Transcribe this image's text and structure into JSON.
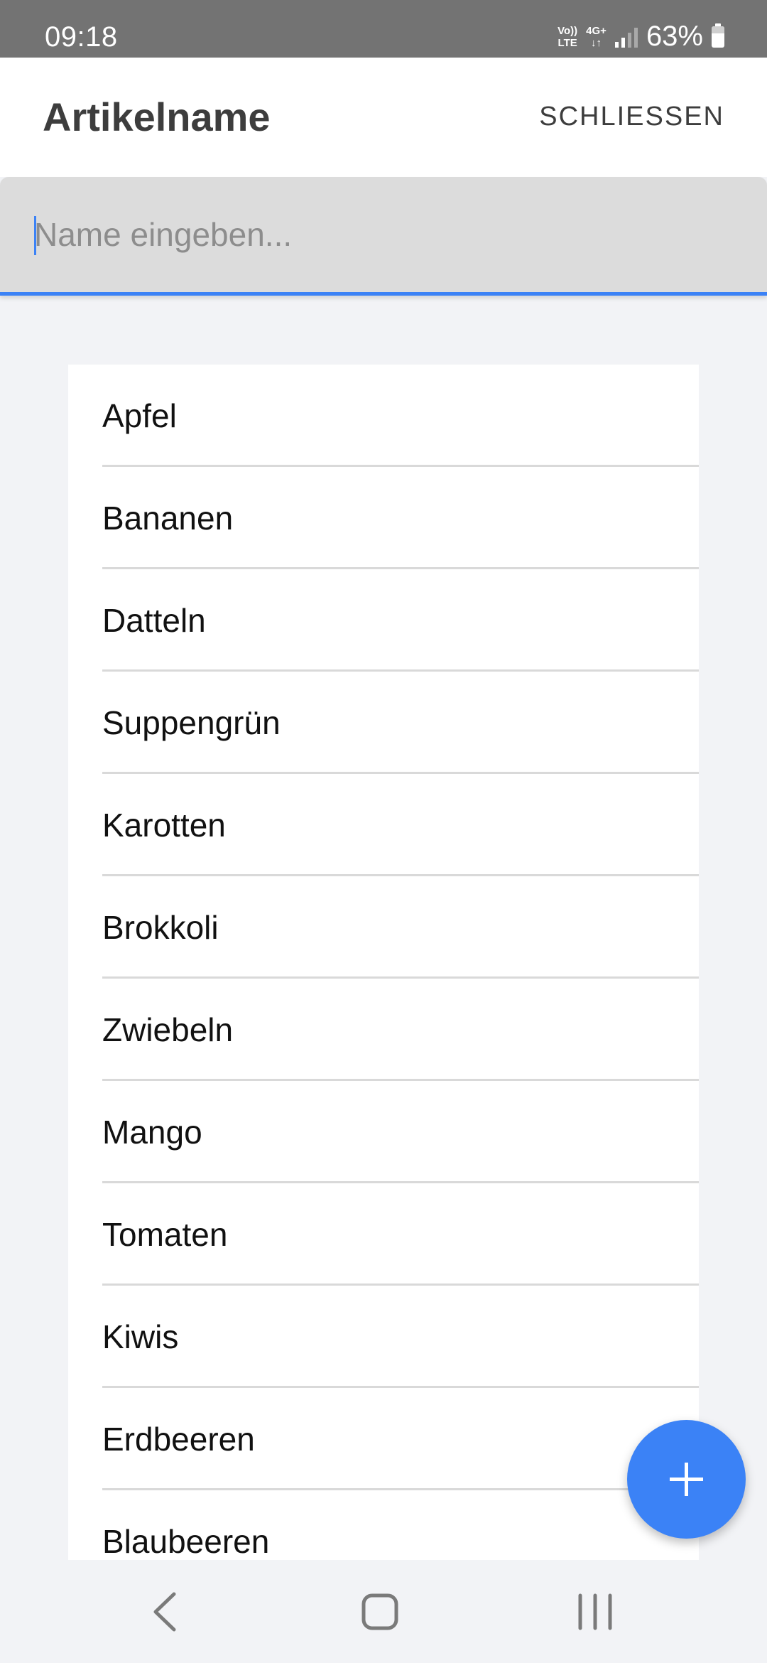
{
  "status_bar": {
    "time": "09:18",
    "volte": "Vo)) LTE",
    "volte_top": "Vo))",
    "volte_bottom": "LTE",
    "network": "4G+",
    "battery_percent": "63%"
  },
  "app_bar": {
    "title": "Artikelname",
    "close_label": "SCHLIESSEN"
  },
  "search": {
    "placeholder": "Name eingeben...",
    "value": ""
  },
  "items": [
    "Apfel",
    "Bananen",
    "Datteln",
    "Suppengrün",
    "Karotten",
    "Brokkoli",
    "Zwiebeln",
    "Mango",
    "Tomaten",
    "Kiwis",
    "Erdbeeren",
    "Blaubeeren"
  ],
  "fab": {
    "icon": "plus-icon"
  },
  "nav_bar": {
    "back_icon": "back-icon",
    "home_icon": "home-icon",
    "recents_icon": "recents-icon"
  },
  "colors": {
    "accent": "#3b82f6",
    "status_bar": "#737373",
    "background": "#f2f3f6",
    "input_background": "#dcdcdc"
  }
}
